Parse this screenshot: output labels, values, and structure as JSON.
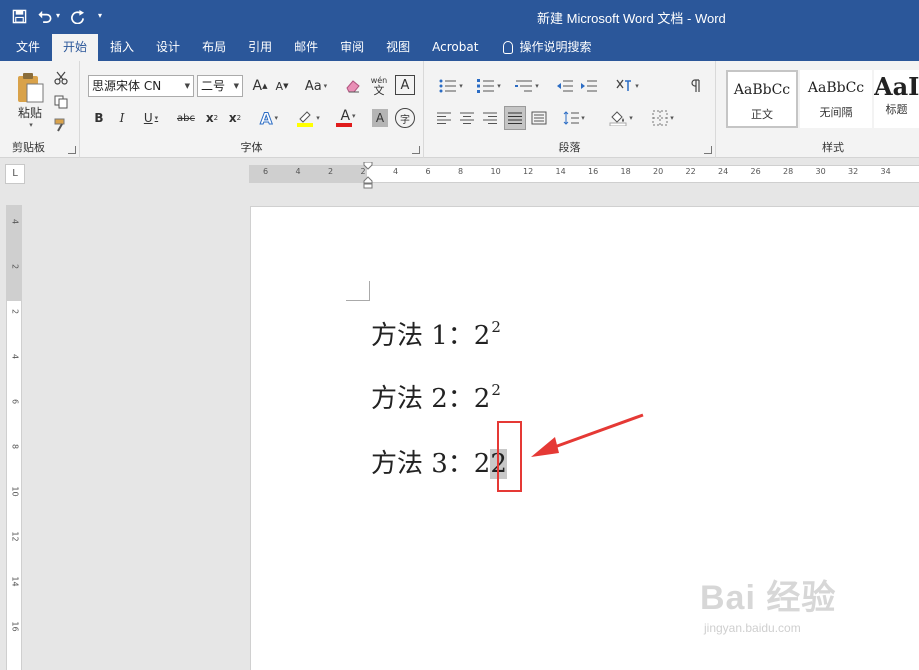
{
  "window": {
    "title": "新建 Microsoft Word 文档 - Word"
  },
  "tabs": [
    {
      "label": "文件"
    },
    {
      "label": "开始"
    },
    {
      "label": "插入"
    },
    {
      "label": "设计"
    },
    {
      "label": "布局"
    },
    {
      "label": "引用"
    },
    {
      "label": "邮件"
    },
    {
      "label": "审阅"
    },
    {
      "label": "视图"
    },
    {
      "label": "Acrobat"
    },
    {
      "label": "操作说明搜索"
    }
  ],
  "ribbon": {
    "clipboard": {
      "label": "剪贴板",
      "paste_label": "粘贴"
    },
    "font": {
      "label": "字体",
      "font_name": "思源宋体 CN",
      "font_size": "二号",
      "grow": "A",
      "shrink": "A",
      "change_case": "Aa",
      "phonetic": "wén",
      "phonetic_sub": "文",
      "bold": "B",
      "italic": "I",
      "underline": "U",
      "strike": "abc",
      "subscript_base": "x",
      "subscript_sub": "2",
      "superscript_base": "x",
      "superscript_sup": "2",
      "effects": "A",
      "color": "A",
      "shade": "A",
      "enclose": "字"
    },
    "paragraph": {
      "label": "段落"
    },
    "styles": {
      "label": "样式",
      "items": [
        {
          "sample": "AaBbCc",
          "name": "正文"
        },
        {
          "sample": "AaBbCc",
          "name": "无间隔"
        },
        {
          "sample": "AaI",
          "name": "标题"
        }
      ]
    }
  },
  "ruler": {
    "corner": "L",
    "h_numbers": [
      "6",
      "4",
      "2",
      "2",
      "4",
      "6",
      "8",
      "10",
      "12",
      "14",
      "16",
      "18",
      "20",
      "22",
      "24",
      "26",
      "28",
      "30",
      "32",
      "34"
    ],
    "v_numbers": [
      "4",
      "2",
      "2",
      "4",
      "6",
      "8",
      "10",
      "12",
      "14",
      "16"
    ]
  },
  "document": {
    "lines": [
      {
        "prefix": "方法 1：2",
        "sup": "2"
      },
      {
        "prefix": "方法 2：2",
        "sup": "2"
      },
      {
        "prefix": "方法 3：2",
        "selected": "2"
      }
    ]
  },
  "watermark": {
    "logo": "Bai 经验",
    "url": "jingyan.baidu.com"
  },
  "colors": {
    "word_blue": "#2b579a",
    "ribbon_bg": "#f3f3f3",
    "highlight_red": "#e53935"
  }
}
